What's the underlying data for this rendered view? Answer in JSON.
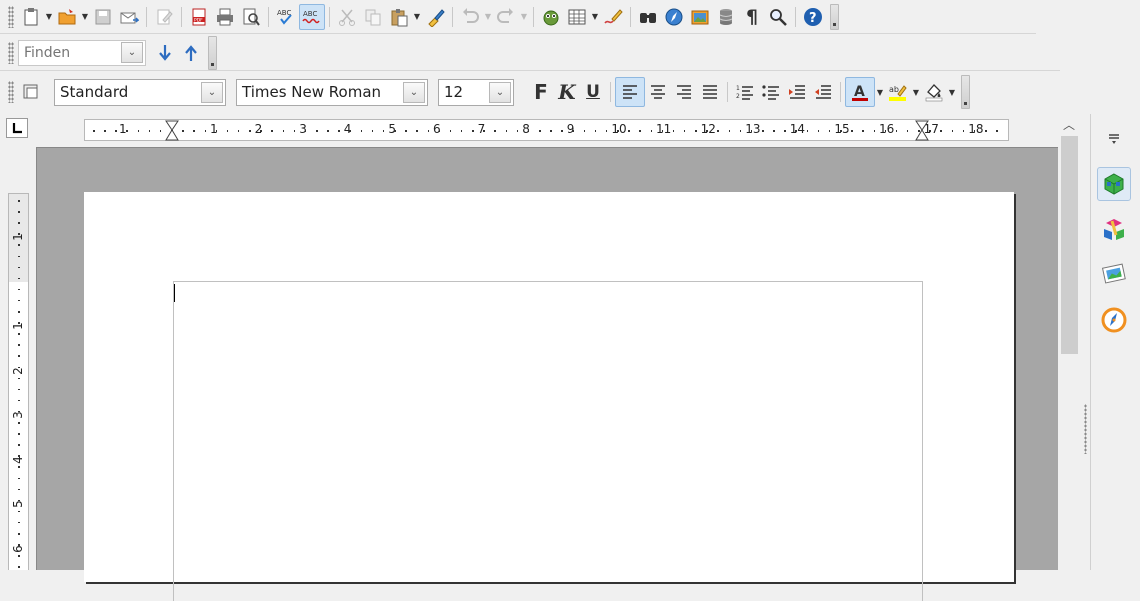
{
  "toolbar_standard": {
    "icons": [
      "new-document-icon",
      "open-folder-icon",
      "save-icon",
      "email-icon",
      "edit-mode-icon",
      "export-pdf-icon",
      "print-icon",
      "print-preview-icon",
      "spellcheck-icon",
      "autospellcheck-icon",
      "cut-icon",
      "copy-icon",
      "paste-icon",
      "clone-formatting-icon",
      "undo-icon",
      "redo-icon",
      "navigator-icon",
      "table-icon",
      "draw-icon",
      "find-replace-icon",
      "navigator-compass-icon",
      "gallery-icon",
      "data-sources-icon",
      "formatting-marks-icon",
      "zoom-icon",
      "help-icon"
    ]
  },
  "find_toolbar": {
    "placeholder": "Finden"
  },
  "format_toolbar": {
    "paragraph_style": "Standard",
    "font_name": "Times New Roman",
    "font_size": "12",
    "bold_label": "F",
    "italic_label": "K",
    "underline_label": "U",
    "alignment_selected": "left"
  },
  "ruler": {
    "numbers": [
      "1",
      "1",
      "2",
      "3",
      "4",
      "5",
      "6",
      "7",
      "8",
      "9",
      "10",
      "11",
      "12",
      "13",
      "14",
      "15",
      "16",
      "17",
      "18"
    ],
    "vertical_numbers": [
      "1",
      "1",
      "2",
      "3",
      "4",
      "5",
      "6"
    ]
  },
  "sidebar": {
    "icons": [
      "sidebar-menu-icon",
      "properties-icon",
      "styles-icon",
      "gallery-icon",
      "navigator-icon"
    ]
  },
  "colors": {
    "toolbar_bg": "#f0f0f0",
    "workspace_bg": "#a6a6a6",
    "page_bg": "#ffffff",
    "active_button": "#cde3f7",
    "font_color_bar": "#c00000",
    "highlight_bar": "#ffff00"
  }
}
